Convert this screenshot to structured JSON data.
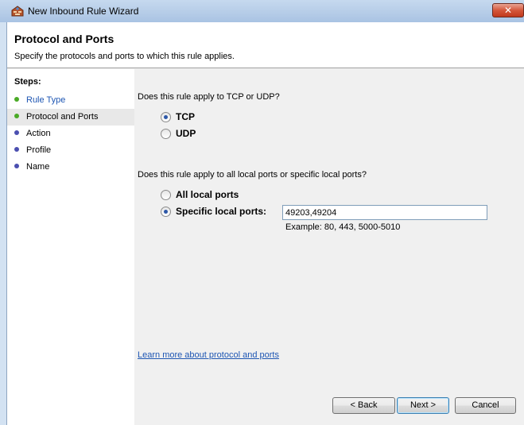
{
  "window": {
    "title": "New Inbound Rule Wizard",
    "close_glyph": "✕"
  },
  "header": {
    "title": "Protocol and Ports",
    "subtitle": "Specify the protocols and ports to which this rule applies."
  },
  "sidebar": {
    "title": "Steps:",
    "items": [
      {
        "label": "Rule Type",
        "state": "done-link"
      },
      {
        "label": "Protocol and Ports",
        "state": "current"
      },
      {
        "label": "Action",
        "state": "pending"
      },
      {
        "label": "Profile",
        "state": "pending"
      },
      {
        "label": "Name",
        "state": "pending"
      }
    ]
  },
  "protocol": {
    "question": "Does this rule apply to TCP or UDP?",
    "options": [
      {
        "label": "TCP",
        "selected": true
      },
      {
        "label": "UDP",
        "selected": false
      }
    ]
  },
  "ports": {
    "question": "Does this rule apply to all local ports or specific local ports?",
    "options": [
      {
        "label": "All local ports",
        "selected": false
      },
      {
        "label": "Specific local ports:",
        "selected": true
      }
    ],
    "value": "49203,49204",
    "example": "Example: 80, 443, 5000-5010"
  },
  "learn_more": "Learn more about protocol and ports",
  "buttons": {
    "back": "< Back",
    "next": "Next >",
    "cancel": "Cancel"
  },
  "colors": {
    "link": "#1e56b3",
    "step_done": "#4aaa26",
    "step_pending": "#4b4fb0"
  },
  "icons": {
    "app": "firewall-icon"
  }
}
